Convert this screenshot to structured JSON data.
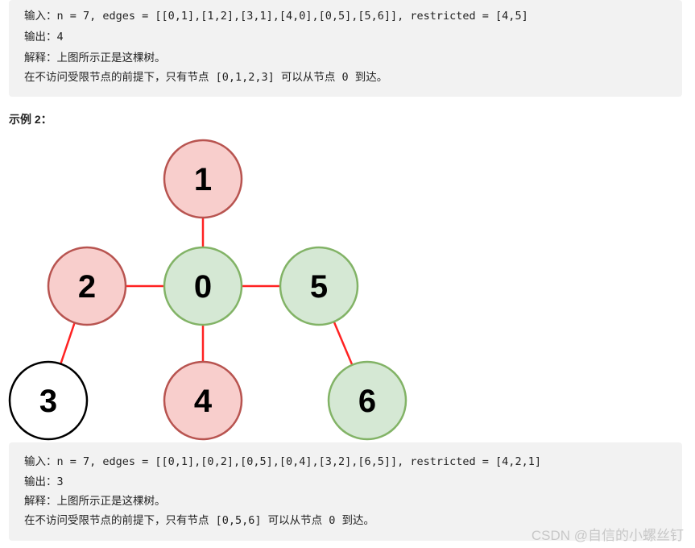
{
  "example1": {
    "lines": [
      "输入：n = 7, edges = [[0,1],[1,2],[3,1],[4,0],[0,5],[5,6]], restricted = [4,5]",
      "输出：4",
      "解释：上图所示正是这棵树。",
      "在不访问受限节点的前提下，只有节点 [0,1,2,3] 可以从节点 0 到达。"
    ]
  },
  "example2": {
    "heading": "示例 2：",
    "graph": {
      "nodes": [
        {
          "id": "0",
          "type": "reachable"
        },
        {
          "id": "1",
          "type": "restricted"
        },
        {
          "id": "2",
          "type": "restricted"
        },
        {
          "id": "3",
          "type": "unreached"
        },
        {
          "id": "4",
          "type": "restricted"
        },
        {
          "id": "5",
          "type": "reachable"
        },
        {
          "id": "6",
          "type": "reachable"
        }
      ],
      "edges": [
        [
          "0",
          "1"
        ],
        [
          "0",
          "2"
        ],
        [
          "0",
          "5"
        ],
        [
          "0",
          "4"
        ],
        [
          "3",
          "2"
        ],
        [
          "6",
          "5"
        ]
      ],
      "colors": {
        "restricted_fill": "#f8cecc",
        "restricted_stroke": "#b85450",
        "reachable_fill": "#d5e8d4",
        "reachable_stroke": "#82b366",
        "unreached_fill": "#ffffff",
        "unreached_stroke": "#000000",
        "edge": "#ff2222"
      }
    },
    "lines": [
      "输入：n = 7, edges = [[0,1],[0,2],[0,5],[0,4],[3,2],[6,5]], restricted = [4,2,1]",
      "输出：3",
      "解释：上图所示正是这棵树。",
      "在不访问受限节点的前提下，只有节点 [0,5,6] 可以从节点 0 到达。"
    ]
  },
  "watermark": "CSDN @自信的小螺丝钉"
}
